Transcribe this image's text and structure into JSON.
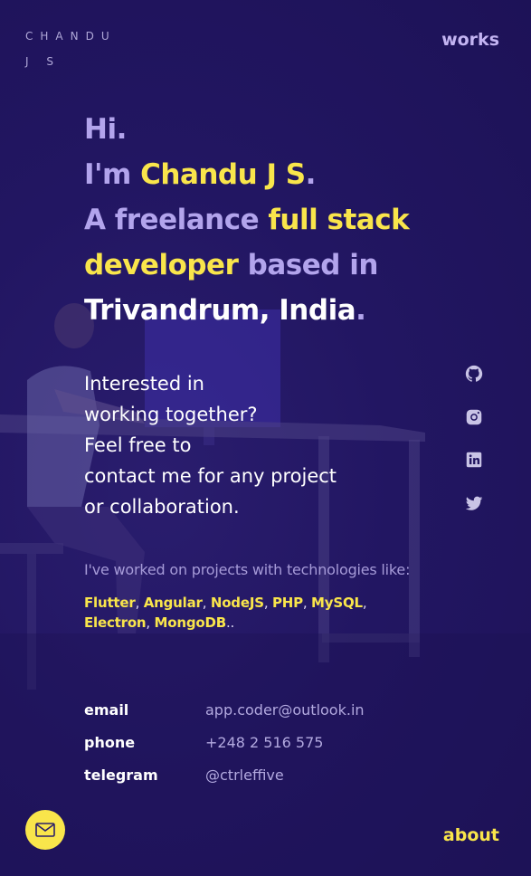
{
  "header": {
    "logo": "CHANDU J S",
    "works_link": "works"
  },
  "hero": {
    "hi": "Hi.",
    "im": "I'm ",
    "name": "Chandu J S",
    "dot1": ".",
    "a_freelance": "A freelance ",
    "full_stack": "full stack",
    "developer": "developer",
    "based_in": " based in",
    "location": "Trivandrum, India",
    "dot2": "."
  },
  "interest": {
    "line1": "Interested in",
    "line2": "working together?",
    "line3": "Feel free to",
    "line4": "contact me for any project",
    "line5": "or collaboration."
  },
  "tech": {
    "intro": "I've worked on projects with technologies like:",
    "items": [
      "Flutter",
      "Angular",
      "NodeJS",
      "PHP",
      "MySQL",
      "Electron",
      "MongoDB"
    ],
    "separator": ", ",
    "ending": ".."
  },
  "contact": {
    "email_label": "email",
    "email_value": "app.coder@outlook.in",
    "phone_label": "phone",
    "phone_value": "+248 2 516 575",
    "telegram_label": "telegram",
    "telegram_value": "@ctrleffive"
  },
  "social": {
    "icons": [
      "github-icon",
      "instagram-icon",
      "linkedin-icon",
      "twitter-icon"
    ],
    "icon_color": "#c9c4e6"
  },
  "footer": {
    "about_link": "about",
    "mail_icon": "mail-icon"
  },
  "colors": {
    "background": "#221662",
    "accent_yellow": "#f9e54b",
    "accent_lavender": "#b2a4ec",
    "text_white": "#ffffff"
  }
}
